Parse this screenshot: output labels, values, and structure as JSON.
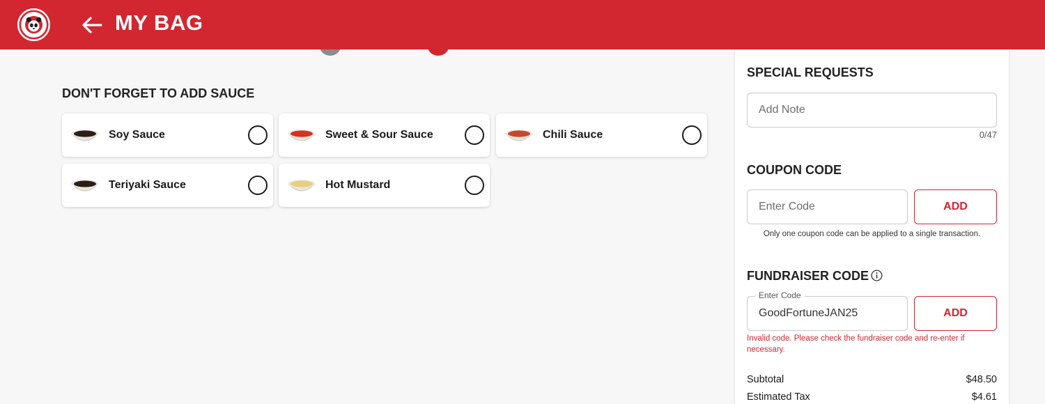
{
  "header": {
    "title": "MY BAG",
    "brand_color": "#d22630",
    "logo_icon": "panda-express-logo",
    "back_icon": "arrow-left-icon"
  },
  "sauces": {
    "heading": "DON'T FORGET TO ADD SAUCE",
    "items": [
      {
        "name": "Soy Sauce",
        "color": "#2a1e16",
        "selected": false
      },
      {
        "name": "Sweet & Sour Sauce",
        "color": "#d8301e",
        "selected": false
      },
      {
        "name": "Chili Sauce",
        "color": "#c8482c",
        "selected": false
      },
      {
        "name": "Teriyaki Sauce",
        "color": "#2a1e16",
        "selected": false
      },
      {
        "name": "Hot Mustard",
        "color": "#e6cf7e",
        "selected": false
      }
    ]
  },
  "special_requests": {
    "title": "SPECIAL REQUESTS",
    "placeholder": "Add Note",
    "counter": "0/47"
  },
  "coupon": {
    "title": "COUPON CODE",
    "placeholder": "Enter Code",
    "button": "ADD",
    "help": "Only one coupon code can be applied to a single transaction."
  },
  "fundraiser": {
    "title": "FUNDRAISER CODE",
    "label": "Enter Code",
    "value": "GoodFortuneJAN25",
    "button": "ADD",
    "error": "Invalid code. Please check the fundraiser code and re-enter if necessary.",
    "error_color": "#d22630"
  },
  "summary": {
    "subtotal_label": "Subtotal",
    "subtotal_value": "$48.50",
    "tax_label": "Estimated Tax",
    "tax_value": "$4.61"
  }
}
